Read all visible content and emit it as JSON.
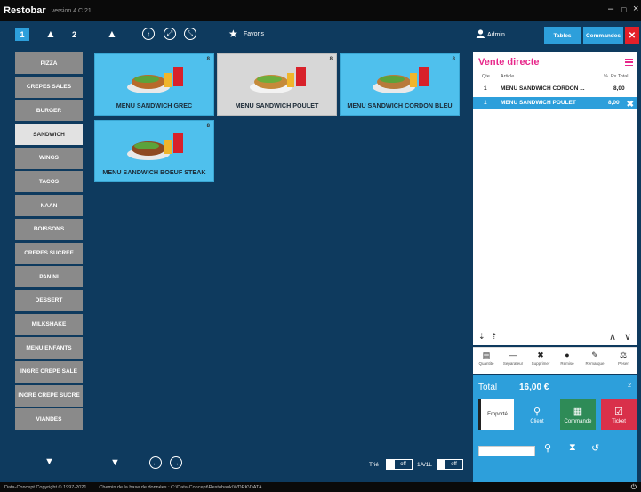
{
  "app": {
    "name": "Restobar",
    "version": "version 4.C.21"
  },
  "nav": {
    "active_page": "1",
    "page2": "2",
    "favorites_label": "Favoris"
  },
  "categories": [
    "PIZZA",
    "CREPES SALES",
    "BURGER",
    "SANDWICH",
    "WINGS",
    "TACOS",
    "NAAN",
    "BOISSONS",
    "CREPES SUCREE",
    "PANINI",
    "DESSERT",
    "MILKSHAKE",
    "MENU ENFANTS",
    "INGRE CREPE SALE",
    "INGRE CREPE SUCRE",
    "VIANDES"
  ],
  "active_category": "SANDWICH",
  "products": [
    {
      "name": "MENU SANDWICH GREC",
      "badge": "8"
    },
    {
      "name": "MENU SANDWICH POULET",
      "badge": "8"
    },
    {
      "name": "MENU SANDWICH CORDON BLEU",
      "badge": "8"
    },
    {
      "name": "MENU SANDWICH BOEUF STEAK",
      "badge": "8"
    }
  ],
  "header": {
    "user": "Admin",
    "tables_label": "Tables",
    "commandes_label": "Commandes"
  },
  "order": {
    "title": "Vente directe",
    "columns": {
      "qty": "Qte",
      "article": "Article",
      "percent": "%",
      "total": "Px Total"
    },
    "rows": [
      {
        "qty": "1",
        "article": "MENU SANDWICH CORDON ...",
        "total": "8,00"
      },
      {
        "qty": "1",
        "article": "MENU SANDWICH POULET",
        "total": "8,00"
      }
    ]
  },
  "tools": [
    "Quantite",
    "Separateur",
    "Supprimer",
    "Remise",
    "Remarque",
    "Peser"
  ],
  "totals": {
    "label": "Total",
    "value": "16,00 €",
    "count": "2"
  },
  "actions": {
    "emporte": "Emporté",
    "client": "Client",
    "commande": "Commande",
    "ticket": "Ticket"
  },
  "bottom": {
    "tri_label": "Trié",
    "tri_value": "off",
    "ratio_label": "1A/1L",
    "ratio_value": "off"
  },
  "statusbar": {
    "copyright": "Data-Concept Copyright © 1997-2021",
    "db_path": "Chemin de la base de données : C:\\Data-Concept\\Restobank\\WDRK\\DATA"
  },
  "colors": {
    "background": "#0e3a5e",
    "tile": "#4fc0ed",
    "accent": "#2d9fdb",
    "pink": "#e7278a",
    "close": "#e32029"
  }
}
